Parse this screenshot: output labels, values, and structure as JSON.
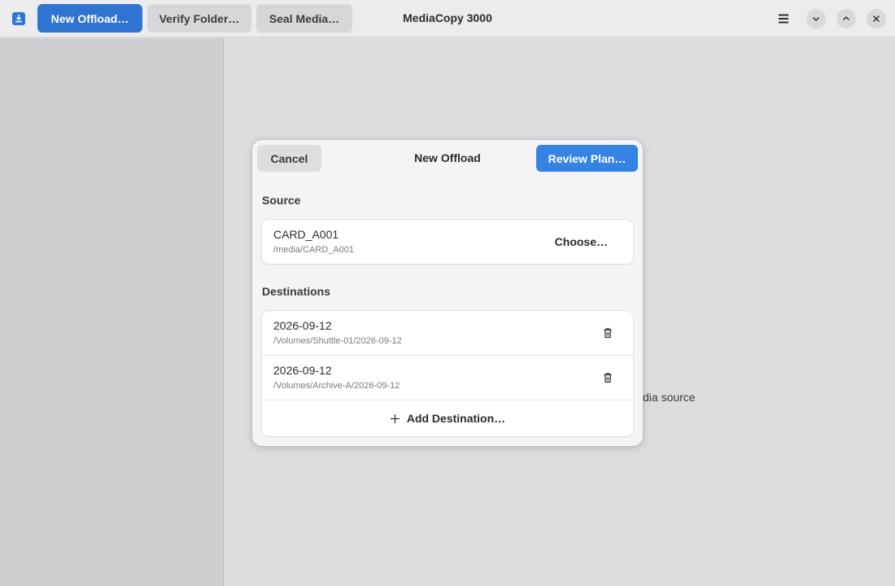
{
  "header": {
    "new_offload": "New Offload…",
    "verify_folder": "Verify Folder…",
    "seal_media": "Seal Media…",
    "title": "MediaCopy 3000"
  },
  "icons": {
    "app": "download-icon",
    "menu": "hamburger-menu-icon",
    "minimize": "chevron-down-icon",
    "maximize": "chevron-up-icon",
    "close": "close-icon",
    "trash": "trash-icon",
    "add": "plus-icon"
  },
  "background": {
    "partial_text": "dia source"
  },
  "dialog": {
    "cancel": "Cancel",
    "title": "New Offload",
    "review": "Review Plan…",
    "source_label": "Source",
    "source": {
      "name": "CARD_A001",
      "path": "/media/CARD_A001",
      "choose": "Choose…"
    },
    "destinations_label": "Destinations",
    "destinations": [
      {
        "name": "2026-09-12",
        "path": "/Volumes/Shuttle-01/2026-09-12"
      },
      {
        "name": "2026-09-12",
        "path": "/Volumes/Archive-A/2026-09-12"
      }
    ],
    "add_destination": "Add Destination…"
  },
  "colors": {
    "accent": "#3584e4",
    "header_primary": "#2f74d0"
  }
}
